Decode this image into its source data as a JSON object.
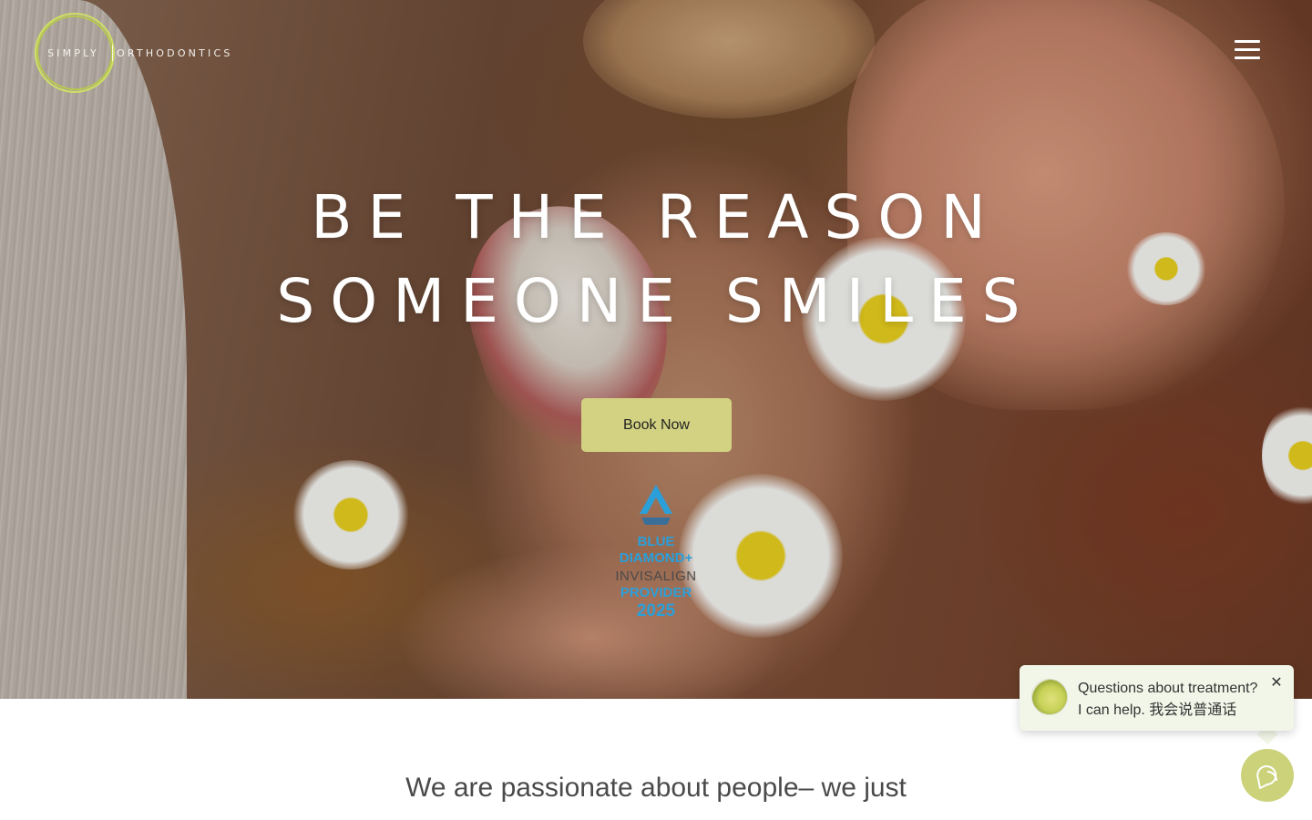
{
  "header": {
    "logo": {
      "word1": "SIMPLY",
      "word2": "ORTHODONTICS",
      "ring_color": "#cfe064"
    },
    "menu_icon": "hamburger-icon"
  },
  "hero": {
    "headline_line1": "BE THE REASON",
    "headline_line2": "SOMEONE SMILES",
    "cta_label": "Book Now",
    "cta_color": "#d2d282",
    "badge": {
      "line1": "BLUE",
      "line2": "DIAMOND+",
      "line3": "INVISALIGN",
      "line4": "PROVIDER",
      "line5": "2025",
      "color": "#2b9fd9"
    }
  },
  "chat": {
    "line1": "Questions about treatment?",
    "line2": "I can help. 我会说普通话",
    "close_icon": "close-icon",
    "fab_icon": "chat-icon",
    "accent": "#cbd27a"
  },
  "intro": {
    "text": "We are passionate about people– we just"
  }
}
